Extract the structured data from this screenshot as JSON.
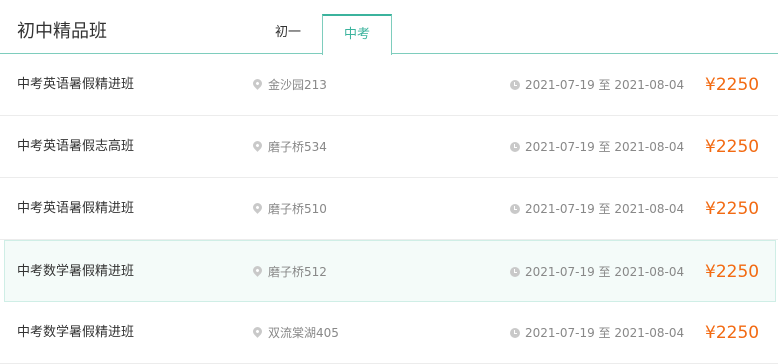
{
  "header": {
    "title": "初中精品班",
    "tabs": [
      {
        "label": "初一",
        "active": false
      },
      {
        "label": "中考",
        "active": true
      }
    ]
  },
  "courses": [
    {
      "name": "中考英语暑假精进班",
      "location": "金沙园213",
      "dates": "2021-07-19 至 2021-08-04",
      "price": "¥2250"
    },
    {
      "name": "中考英语暑假志高班",
      "location": "磨子桥534",
      "dates": "2021-07-19 至 2021-08-04",
      "price": "¥2250"
    },
    {
      "name": "中考英语暑假精进班",
      "location": "磨子桥510",
      "dates": "2021-07-19 至 2021-08-04",
      "price": "¥2250"
    },
    {
      "name": "中考数学暑假精进班",
      "location": "磨子桥512",
      "dates": "2021-07-19 至 2021-08-04",
      "price": "¥2250"
    },
    {
      "name": "中考数学暑假精进班",
      "location": "双流棠湖405",
      "dates": "2021-07-19 至 2021-08-04",
      "price": "¥2250"
    }
  ],
  "colors": {
    "accent": "#3bb39d",
    "price": "#f26a12",
    "highlight_row": "#f4fbf9"
  },
  "icons": {
    "location": "location-pin-icon",
    "time": "clock-icon"
  }
}
